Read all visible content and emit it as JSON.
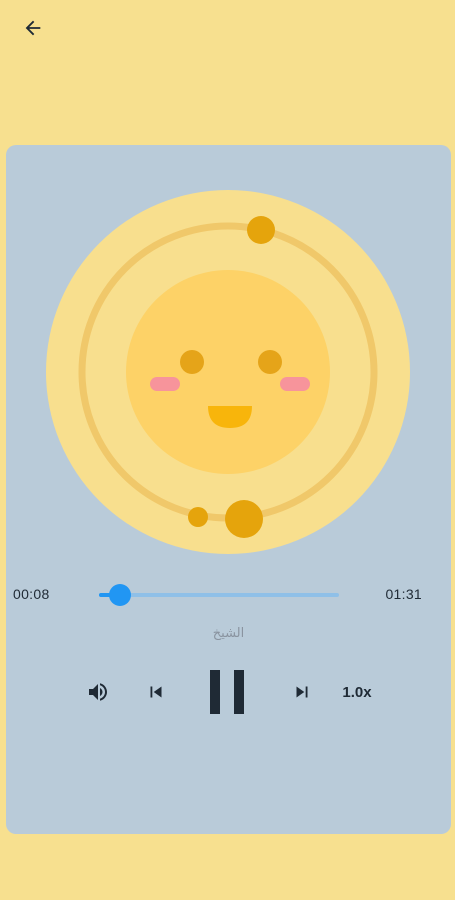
{
  "header": {
    "back_icon": "arrow-left-icon"
  },
  "player": {
    "current_time": "00:08",
    "total_time": "01:31",
    "progress": 0.088,
    "track_title": "الشيخ",
    "speed_label": "1.0x",
    "controls": {
      "volume_icon": "volume-icon",
      "previous_icon": "skip-previous-icon",
      "play_pause_icon": "pause-icon",
      "next_icon": "skip-next-icon"
    }
  },
  "colors": {
    "background": "#f7e08f",
    "card": "#b9cbd9",
    "accent": "#2196f3",
    "track": "#8fc0e8"
  }
}
